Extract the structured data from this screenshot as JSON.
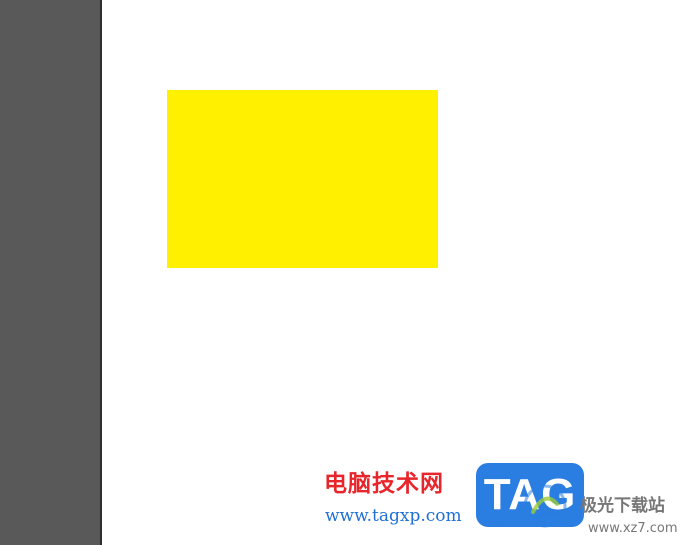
{
  "colors": {
    "pasteboard": "#595959",
    "artboard": "#ffffff",
    "shape_fill": "#fff000",
    "watermark_red": "#e8252b",
    "watermark_blue": "#1f6fd6",
    "badge_blue": "#2a7de1",
    "site_gray": "#777777"
  },
  "canvas": {
    "shape": {
      "kind": "rectangle",
      "fill": "#fff000"
    }
  },
  "watermarks": {
    "left": {
      "title": "电脑技术网",
      "url": "www.tagxp.com",
      "badge_text": "TAG"
    },
    "right": {
      "logo": "xz7-logo-icon",
      "name": "极光下载站",
      "url": "www.xz7.com"
    }
  }
}
